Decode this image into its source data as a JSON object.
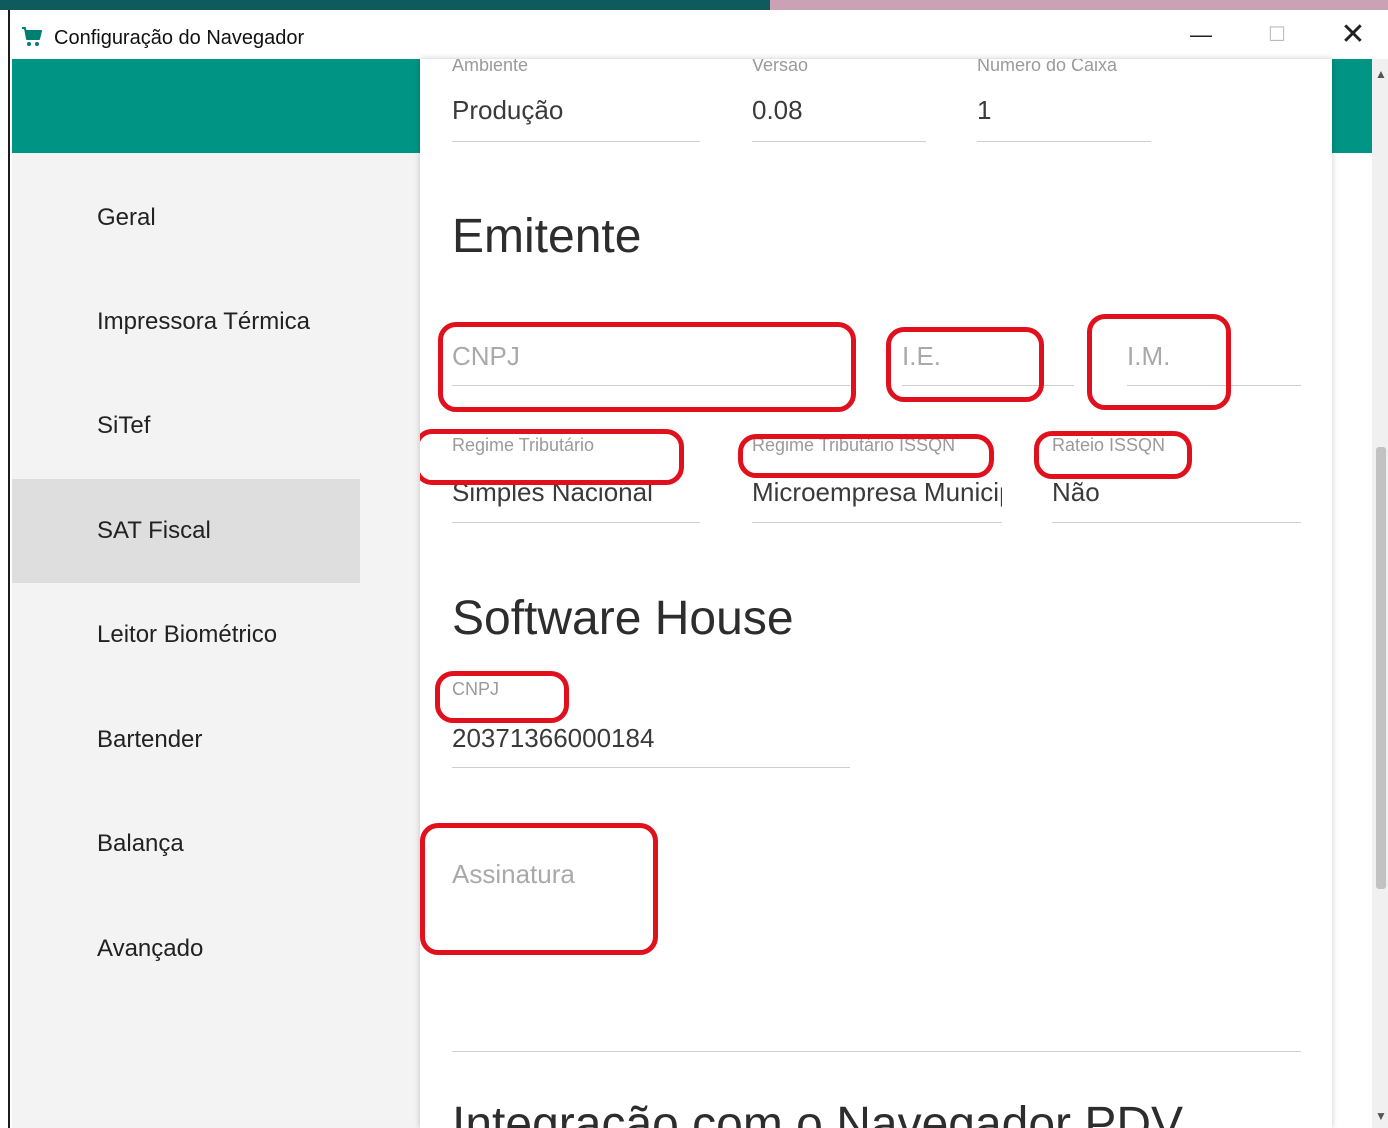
{
  "window": {
    "title": "Configuração do Navegador",
    "minimize_symbol": "—",
    "maximize_symbol": "☐",
    "close_symbol": "✕"
  },
  "colors": {
    "accent": "#009484",
    "highlight": "#e0101d",
    "sidebar_active": "#dedede"
  },
  "sidebar": {
    "items": [
      {
        "label": "Geral",
        "active": false
      },
      {
        "label": "Impressora Térmica",
        "active": false
      },
      {
        "label": "SiTef",
        "active": false
      },
      {
        "label": "SAT Fiscal",
        "active": true
      },
      {
        "label": "Leitor Biométrico",
        "active": false
      },
      {
        "label": "Bartender",
        "active": false
      },
      {
        "label": "Balança",
        "active": false
      },
      {
        "label": "Avançado",
        "active": false
      }
    ]
  },
  "top_fields": {
    "ambiente": {
      "label": "Ambiente",
      "value": "Produção"
    },
    "versao": {
      "label": "Versao",
      "value": "0.08"
    },
    "numero_caixa": {
      "label": "Numero do Caixa",
      "value": "1"
    }
  },
  "emitente": {
    "title": "Emitente",
    "cnpj": {
      "placeholder": "CNPJ"
    },
    "ie": {
      "placeholder": "I.E."
    },
    "im": {
      "placeholder": "I.M."
    },
    "regime_tributario": {
      "label": "Regime Tributário",
      "value": "Simples Nacional"
    },
    "regime_issqn": {
      "label": "Regime Tributário ISSQN",
      "value": "Microempresa Municipal"
    },
    "rateio_issqn": {
      "label": "Rateio ISSQN",
      "value": "Não"
    }
  },
  "software_house": {
    "title": "Software House",
    "cnpj": {
      "label": "CNPJ",
      "value": "20371366000184"
    },
    "assinatura": {
      "placeholder": "Assinatura"
    }
  },
  "next_section": {
    "title": "Integração com o Navegador PDV"
  },
  "icons": {
    "app": "shopping-cart-icon",
    "scroll_up": "triangle-up-icon",
    "scroll_down": "triangle-down-icon"
  }
}
